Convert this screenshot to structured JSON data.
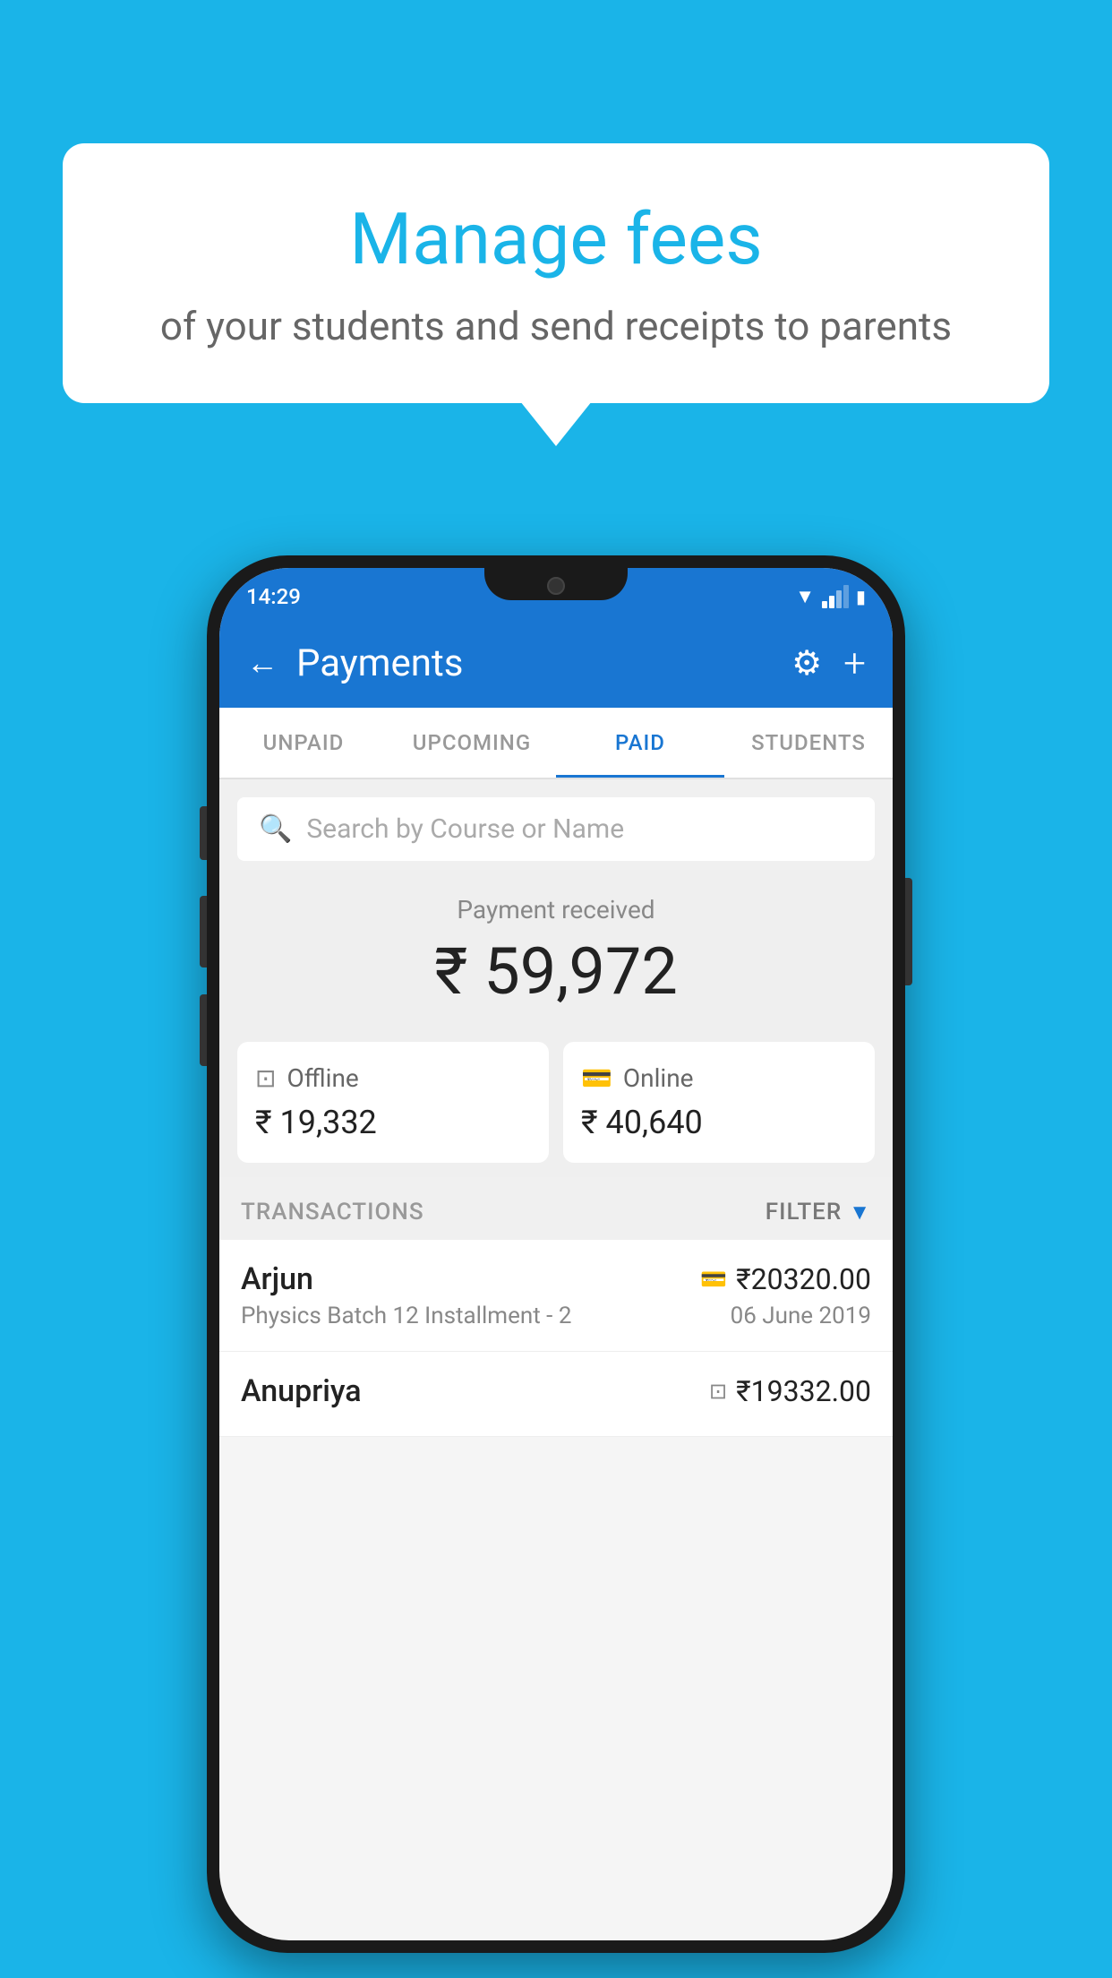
{
  "background_color": "#1ab4e8",
  "speech_bubble": {
    "title": "Manage fees",
    "subtitle": "of your students and send receipts to parents"
  },
  "status_bar": {
    "time": "14:29"
  },
  "header": {
    "title": "Payments",
    "back_label": "←",
    "gear_label": "⚙",
    "plus_label": "+"
  },
  "tabs": [
    {
      "id": "unpaid",
      "label": "UNPAID",
      "active": false
    },
    {
      "id": "upcoming",
      "label": "UPCOMING",
      "active": false
    },
    {
      "id": "paid",
      "label": "PAID",
      "active": true
    },
    {
      "id": "students",
      "label": "STUDENTS",
      "active": false
    }
  ],
  "search": {
    "placeholder": "Search by Course or Name"
  },
  "payment_summary": {
    "label": "Payment received",
    "amount": "₹ 59,972",
    "offline": {
      "label": "Offline",
      "amount": "₹ 19,332"
    },
    "online": {
      "label": "Online",
      "amount": "₹ 40,640"
    }
  },
  "transactions": {
    "label": "TRANSACTIONS",
    "filter_label": "FILTER",
    "items": [
      {
        "name": "Arjun",
        "course": "Physics Batch 12 Installment - 2",
        "amount": "₹20320.00",
        "date": "06 June 2019",
        "type": "online"
      },
      {
        "name": "Anupriya",
        "course": "",
        "amount": "₹19332.00",
        "date": "",
        "type": "offline"
      }
    ]
  }
}
